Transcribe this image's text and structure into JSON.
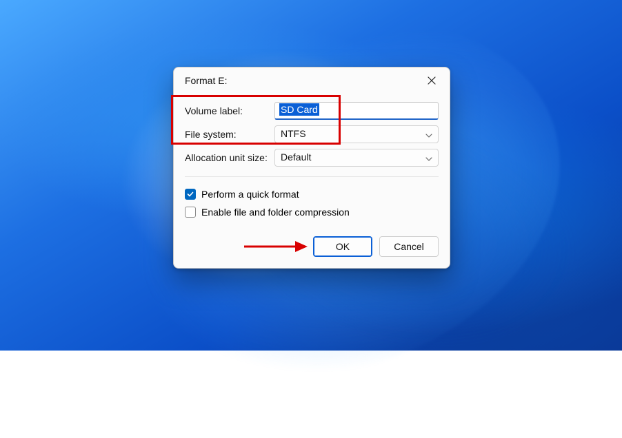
{
  "dialog": {
    "title": "Format E:",
    "fields": {
      "volume_label": {
        "label": "Volume label:",
        "value": "SD Card"
      },
      "file_system": {
        "label": "File system:",
        "value": "NTFS"
      },
      "allocation": {
        "label": "Allocation unit size:",
        "value": "Default"
      }
    },
    "checkboxes": {
      "quick_format": {
        "label": "Perform a quick format",
        "checked": true
      },
      "compression": {
        "label": "Enable file and folder compression",
        "checked": false
      }
    },
    "buttons": {
      "ok": "OK",
      "cancel": "Cancel"
    }
  },
  "annotations": {
    "highlight_color": "#d80000",
    "arrow_color": "#d80000"
  }
}
